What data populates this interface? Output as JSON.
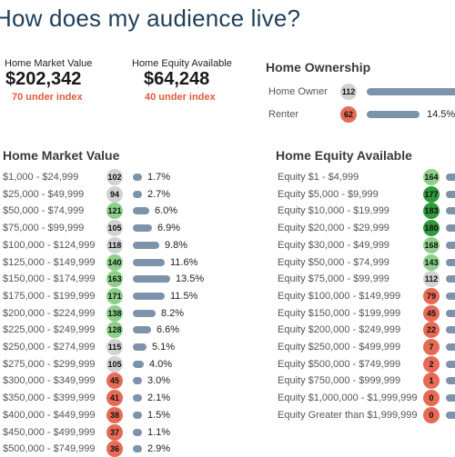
{
  "page_title": "How does my audience live?",
  "kpis": [
    {
      "label": "Home Market Value",
      "value": "$202,342",
      "sub": "70 under index"
    },
    {
      "label": "Home Equity Available",
      "value": "$64,248",
      "sub": "40 under index"
    }
  ],
  "home_ownership": {
    "title": "Home Ownership",
    "rows": [
      {
        "label": "Home Owner",
        "index": "112",
        "color": "grey",
        "pct": "",
        "bar_fraction": 1.0
      },
      {
        "label": "Renter",
        "index": "62",
        "color": "red",
        "pct": "14.5%",
        "bar_fraction": 0.145
      }
    ]
  },
  "home_market_value": {
    "title": "Home Market Value",
    "rows": [
      {
        "label": "$1,000 - $24,999",
        "index": "102",
        "color": "grey",
        "pct": "1.7%",
        "value": 1.7
      },
      {
        "label": "$25,000 - $49,999",
        "index": "94",
        "color": "grey",
        "pct": "2.7%",
        "value": 2.7
      },
      {
        "label": "$50,000 - $74,999",
        "index": "121",
        "color": "green",
        "pct": "6.0%",
        "value": 6.0
      },
      {
        "label": "$75,000 - $99,999",
        "index": "105",
        "color": "grey",
        "pct": "6.9%",
        "value": 6.9
      },
      {
        "label": "$100,000 - $124,999",
        "index": "118",
        "color": "grey",
        "pct": "9.8%",
        "value": 9.8
      },
      {
        "label": "$125,000 - $149,999",
        "index": "140",
        "color": "green",
        "pct": "11.6%",
        "value": 11.6
      },
      {
        "label": "$150,000 - $174,999",
        "index": "163",
        "color": "green",
        "pct": "13.5%",
        "value": 13.5
      },
      {
        "label": "$175,000 - $199,999",
        "index": "171",
        "color": "green",
        "pct": "11.5%",
        "value": 11.5
      },
      {
        "label": "$200,000 - $224,999",
        "index": "138",
        "color": "green",
        "pct": "8.2%",
        "value": 8.2
      },
      {
        "label": "$225,000 - $249,999",
        "index": "128",
        "color": "green",
        "pct": "6.6%",
        "value": 6.6
      },
      {
        "label": "$250,000 - $274,999",
        "index": "115",
        "color": "grey",
        "pct": "5.1%",
        "value": 5.1
      },
      {
        "label": "$275,000 - $299,999",
        "index": "105",
        "color": "grey",
        "pct": "4.0%",
        "value": 4.0
      },
      {
        "label": "$300,000 - $349,999",
        "index": "45",
        "color": "red",
        "pct": "3.0%",
        "value": 3.0
      },
      {
        "label": "$350,000 - $399,999",
        "index": "41",
        "color": "red",
        "pct": "2.1%",
        "value": 2.1
      },
      {
        "label": "$400,000 - $449,999",
        "index": "38",
        "color": "red",
        "pct": "1.5%",
        "value": 1.5
      },
      {
        "label": "$450,000 - $499,999",
        "index": "37",
        "color": "red",
        "pct": "1.1%",
        "value": 1.1
      },
      {
        "label": "$500,000 - $749,999",
        "index": "36",
        "color": "red",
        "pct": "2.9%",
        "value": 2.9
      }
    ]
  },
  "home_equity_available": {
    "title": "Home Equity Available",
    "rows": [
      {
        "label": "Equity $1 - $4,999",
        "index": "164",
        "color": "green"
      },
      {
        "label": "Equity $5,000 - $9,999",
        "index": "177",
        "color": "dgreen"
      },
      {
        "label": "Equity $10,000 - $19,999",
        "index": "183",
        "color": "dgreen"
      },
      {
        "label": "Equity $20,000 - $29,999",
        "index": "180",
        "color": "dgreen"
      },
      {
        "label": "Equity $30,000 - $49,999",
        "index": "168",
        "color": "green"
      },
      {
        "label": "Equity $50,000 - $74,999",
        "index": "143",
        "color": "green"
      },
      {
        "label": "Equity $75,000 - $99,999",
        "index": "112",
        "color": "grey"
      },
      {
        "label": "Equity $100,000 - $149,999",
        "index": "79",
        "color": "red"
      },
      {
        "label": "Equity $150,000 - $199,999",
        "index": "45",
        "color": "red"
      },
      {
        "label": "Equity $200,000 - $249,999",
        "index": "22",
        "color": "red"
      },
      {
        "label": "Equity $250,000 - $499,999",
        "index": "7",
        "color": "red"
      },
      {
        "label": "Equity $500,000 - $749,999",
        "index": "2",
        "color": "red"
      },
      {
        "label": "Equity $750,000 - $999,999",
        "index": "1",
        "color": "red"
      },
      {
        "label": "Equity $1,000,000 - $1,999,999",
        "index": "0",
        "color": "red"
      },
      {
        "label": "Equity Greater than $1,999,999",
        "index": "0",
        "color": "red"
      }
    ]
  }
}
